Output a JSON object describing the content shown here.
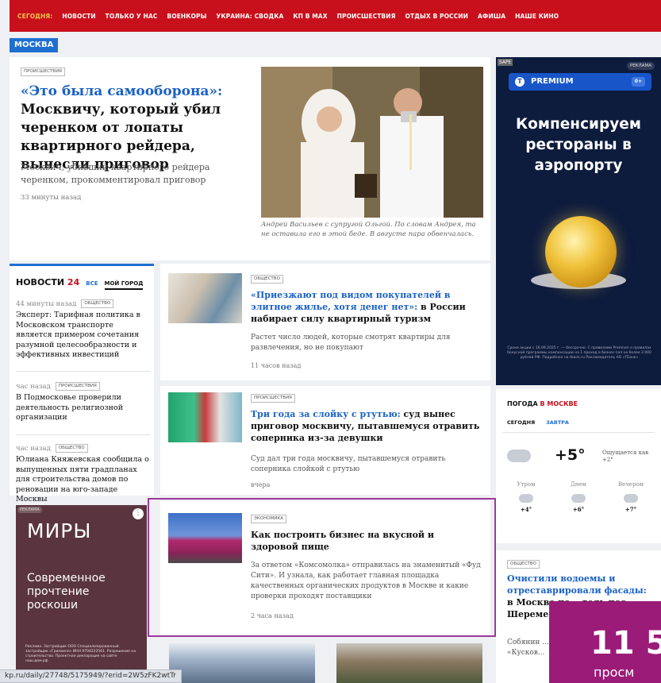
{
  "nav": {
    "today": "СЕГОДНЯ:",
    "items": [
      "НОВОСТИ",
      "ТОЛЬКО У НАС",
      "ВОЕНКОРЫ",
      "УКРАИНА: СВОДКА",
      "КП В MAX",
      "ПРОИСШЕСТВИЯ",
      "ОТДЫХ В РОССИИ",
      "АФИША",
      "НАШЕ КИНО"
    ]
  },
  "city": "МОСКВА",
  "featured": {
    "tag": "ПРОИСШЕСТВИЯ",
    "title_quote": "«Это была самооборона»:",
    "title_rest": " Москвичу, который убил черенком от лопаты квартирного рейдера, вынесли приговор",
    "lead": "Москвич, убивший квартирного рейдера черенком, прокомментировал приговор",
    "time": "33 минуты назад",
    "caption": "Андрей Васильев с супругой Ольгой. По словам Андрея, та не оставила его в этой беде. В августе пара обвенчалась."
  },
  "ad_right": {
    "sape": "SAPE",
    "reklama": "РЕКЛАМА",
    "brand": "PREMIUM",
    "age": "0+",
    "headline": "Компенсируем рестораны в аэропорту",
    "fine": "Сроки акции с 16.09.2025 г. — бессрочно. С правилами Premium о правилах бонусной программы компенсации на 1 проход в бизнес-зал не более 3 000 рублей РФ. Подробнее на tbank.ru Рекламодатель АО «ТБанк»"
  },
  "news24": {
    "title": "НОВОСТИ",
    "title_num": "24",
    "tab_all": "ВСЕ",
    "tab_city": "МОЙ ГОРОД",
    "items": [
      {
        "time": "44 минуты назад",
        "tag": "ОБЩЕСТВО",
        "text": "Эксперт: Тарифная политика в Московском транспорте является примером сочетания разумной целесообразности и эффективных инвестиций"
      },
      {
        "time": "час назад",
        "tag": "ПРОИСШЕСТВИЯ",
        "text": "В Подмосковье проверили деятельность религиозной организации"
      },
      {
        "time": "час назад",
        "tag": "ОБЩЕСТВО",
        "text": "Юлиана Княжевская сообщила о выпущенных пяти градпланах для строительства домов по реновации на юго-западе Москвы"
      }
    ]
  },
  "ad_left": {
    "reklama": "РЕКЛАМА",
    "brand": "МИРЫ",
    "slogan": "Современное прочтение роскоши",
    "fine": "Реклама. Застройщик ООО Специализированный застройщик «Гринвилл» ИНН 9704222561. Разрешение на строительство. Проектная декларация на сайте наш.дом.рф"
  },
  "stories": [
    {
      "tag": "ОБЩЕСТВО",
      "title_quote": "«Приезжают под видом покупателей в элитное жилье, хотя денег нет»:",
      "title_rest": " в России набирает силу квартирный туризм",
      "lead": "Растет число людей, которые смотрят квартиры для развлечения, но не покупают",
      "time": "11 часов назад"
    },
    {
      "tag": "ПРОИСШЕСТВИЯ",
      "title_quote": "Три года за слойку с ртутью:",
      "title_rest": " суд вынес приговор москвичу, пытавшемуся отравить соперника из-за девушки",
      "lead": "Суд дал три года москвичу, пытавшемуся отравить соперника слойкой с ртутью",
      "time": "вчера"
    },
    {
      "tag": "ЭКОНОМИКА",
      "title_quote": "",
      "title_rest": "Как построить бизнес на вкусной и здоровой пище",
      "lead": "За ответом «Комсомолка» отправилась на знаменитый «Фуд Сити». И узнала, как работает главная площадка качественных органических продуктов в Москве и какие проверки проходят поставщики",
      "time": "2 часа назад"
    }
  ],
  "weather": {
    "title": "ПОГОДА",
    "title_city": " В МОСКВЕ",
    "tab_today": "СЕГОДНЯ",
    "tab_tomorrow": "ЗАВТРА",
    "temp": "+5°",
    "feels": "Ощущается как +2°",
    "parts": [
      {
        "label": "Утром",
        "temp": "+4°"
      },
      {
        "label": "Днем",
        "temp": "+6°"
      },
      {
        "label": "Вечером",
        "temp": "+7°"
      }
    ]
  },
  "right_story": {
    "tag": "ОБЩЕСТВО",
    "title_quote": "Очистили водоемы и отреставрировали фасады:",
    "title_rest": " в Москве по... тель пос... Шереме...",
    "lead": "Собянин ... нии рест... ского дом... «Кусков..."
  },
  "overlay": {
    "num": "11 5",
    "sub": "просм"
  },
  "status_url": "kp.ru/daily/27748/5175949/?erid=2W5zFK2wtTr"
}
